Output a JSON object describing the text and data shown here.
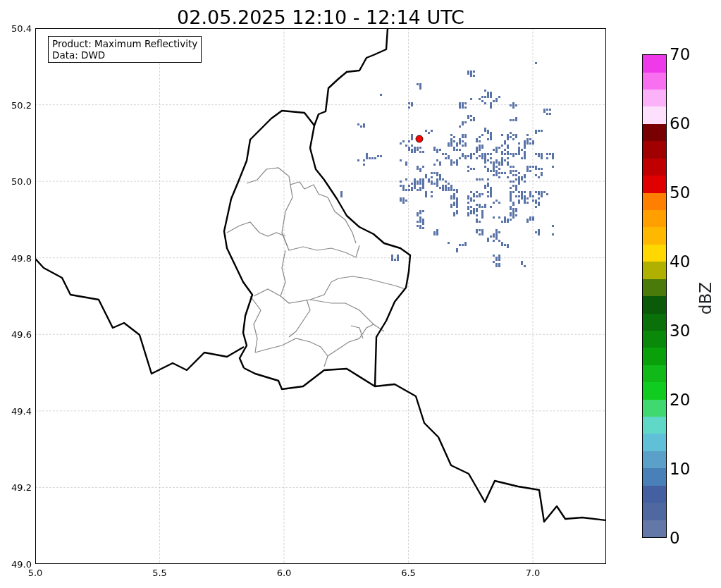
{
  "title": "02.05.2025 12:10 - 12:14 UTC",
  "legend": [
    "Product: Maximum Reflectivity",
    "Data: DWD"
  ],
  "axes": {
    "yticks": [
      "50.4",
      "50.2",
      "50.0",
      "49.8",
      "49.6",
      "49.4",
      "49.2",
      "49.0"
    ],
    "xticks": [
      "5.0",
      "5.5",
      "6.0",
      "6.5",
      "7.0"
    ]
  },
  "colorbar": {
    "label": "dBZ",
    "ticks": [
      "70",
      "60",
      "50",
      "40",
      "30",
      "20",
      "10",
      "0"
    ],
    "bins": [
      {
        "color": "#6478a8"
      },
      {
        "color": "#5068a0"
      },
      {
        "color": "#4460a0"
      },
      {
        "color": "#4a80b8"
      },
      {
        "color": "#5aa0c8"
      },
      {
        "color": "#60c0d8"
      },
      {
        "color": "#60d8c8"
      },
      {
        "color": "#40d870"
      },
      {
        "color": "#10cc20"
      },
      {
        "color": "#10b818"
      },
      {
        "color": "#0aa00a"
      },
      {
        "color": "#0a880a"
      },
      {
        "color": "#0a700a"
      },
      {
        "color": "#0a5a0a"
      },
      {
        "color": "#4a7a0a"
      },
      {
        "color": "#b0b000"
      },
      {
        "color": "#ffd800"
      },
      {
        "color": "#ffb800"
      },
      {
        "color": "#ffa000"
      },
      {
        "color": "#ff8000"
      },
      {
        "color": "#e00000"
      },
      {
        "color": "#c00000"
      },
      {
        "color": "#a00000"
      },
      {
        "color": "#780000"
      },
      {
        "color": "#fde0fc"
      },
      {
        "color": "#fbb2f8"
      },
      {
        "color": "#f870f0"
      },
      {
        "color": "#ee3ae8"
      }
    ]
  }
}
